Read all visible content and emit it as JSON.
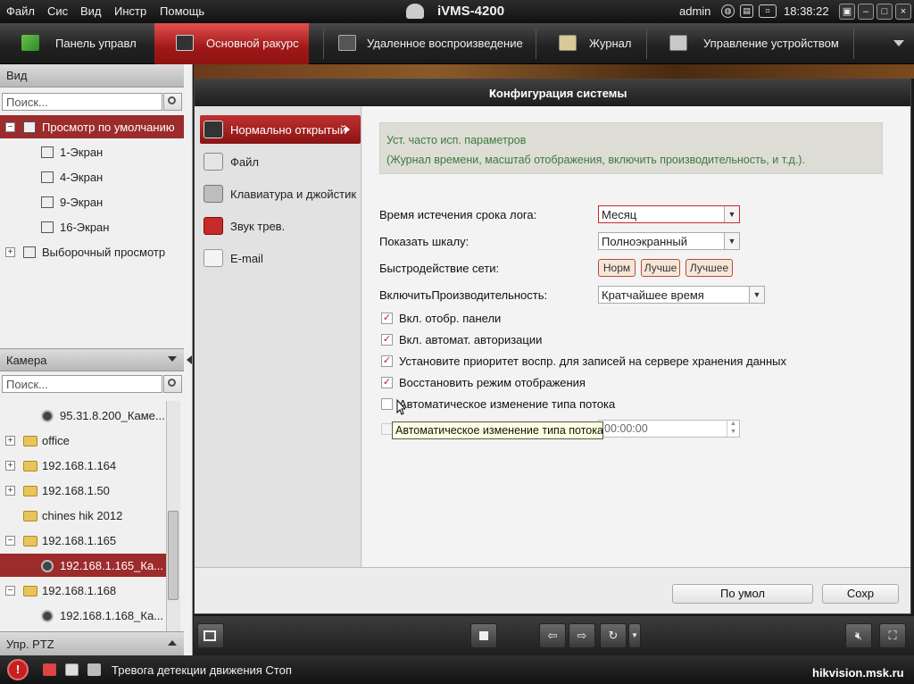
{
  "menubar": {
    "items": [
      "Файл",
      "Сис",
      "Вид",
      "Инстр",
      "Помощь"
    ],
    "app_title": "iVMS-4200",
    "user": "admin",
    "clock": "18:38:22"
  },
  "tabs": [
    {
      "label": "Панель управл",
      "icon": "grid-icon",
      "active": false
    },
    {
      "label": "Основной ракурс",
      "icon": "camera-view-icon",
      "active": true
    },
    {
      "label": "Удаленное воспроизведение",
      "icon": "playback-icon",
      "active": false
    },
    {
      "label": "Журнал",
      "icon": "log-icon",
      "active": false
    },
    {
      "label": "Управление устройством",
      "icon": "device-icon",
      "active": false
    }
  ],
  "view_panel": {
    "title": "Вид",
    "search_placeholder": "Поиск...",
    "tree": [
      {
        "label": "Просмотр по умолчанию",
        "level": 0,
        "expander": "−",
        "selected": true
      },
      {
        "label": "1-Экран",
        "level": 1
      },
      {
        "label": "4-Экран",
        "level": 1
      },
      {
        "label": "9-Экран",
        "level": 1
      },
      {
        "label": "16-Экран",
        "level": 1
      },
      {
        "label": "Выборочный просмотр",
        "level": 0,
        "expander": "+"
      }
    ]
  },
  "camera_panel": {
    "title": "Камера",
    "search_placeholder": "Поиск...",
    "tree": [
      {
        "label": "95.31.8.200_Каме...",
        "kind": "camera"
      },
      {
        "label": "office",
        "kind": "folder",
        "expander": "+"
      },
      {
        "label": "192.168.1.164",
        "kind": "folder",
        "expander": "+"
      },
      {
        "label": "192.168.1.50",
        "kind": "folder",
        "expander": "+"
      },
      {
        "label": "chines hik 2012",
        "kind": "folder"
      },
      {
        "label": "192.168.1.165",
        "kind": "folder",
        "expander": "−"
      },
      {
        "label": "192.168.1.165_Ка...",
        "kind": "camera",
        "selected": true
      },
      {
        "label": "192.168.1.168",
        "kind": "folder",
        "expander": "−"
      },
      {
        "label": "192.168.1.168_Ка...",
        "kind": "camera"
      }
    ]
  },
  "ptz_panel": {
    "title": "Упр. PTZ"
  },
  "dialog": {
    "title": "Конфигурация системы",
    "close": "×",
    "nav": [
      {
        "label": "Нормально открытый",
        "icon": "monitor-icon",
        "active": true
      },
      {
        "label": "Файл",
        "icon": "file-gear-icon"
      },
      {
        "label": "Клавиатура и джойстик",
        "icon": "keyboard-icon"
      },
      {
        "label": "Звук трев.",
        "icon": "alarm-sound-icon"
      },
      {
        "label": "E-mail",
        "icon": "email-icon"
      }
    ],
    "info": {
      "line1": "Уст. часто исп. параметров",
      "line2": "(Журнал времени, масштаб отображения, включить производительность, и т.д.)."
    },
    "form": {
      "log_expiry_label": "Время истечения срока лога:",
      "log_expiry_value": "Месяц",
      "show_scale_label": "Показать шкалу:",
      "show_scale_value": "Полноэкранный",
      "network_label": "Быстродействие сети:",
      "network_options": [
        "Норм",
        "Лучше",
        "Лучшее"
      ],
      "performance_label": "ВключитьПроизводительность:",
      "performance_value": "Кратчайшее время"
    },
    "checkboxes": [
      {
        "label": "Вкл. отобр. панели",
        "checked": true
      },
      {
        "label": "Вкл. автомат. авторизации",
        "checked": true
      },
      {
        "label": "Установите приоритет воспр. для записей на сервере хранения данных",
        "checked": true
      },
      {
        "label": "Восстановить режим отображения",
        "checked": true
      },
      {
        "label": "Автоматическое изменение типа потока",
        "checked": false
      }
    ],
    "time_value": "00:00:00",
    "tooltip": "Автоматическое изменение типа потока",
    "buttons": {
      "default": "По умол",
      "save": "Сохр"
    }
  },
  "statusbar": {
    "alarm_glyph": "!",
    "message": "Тревога детекции движения Стоп",
    "watermark": "hikvision.msk.ru"
  },
  "colors": {
    "accent": "#a01818",
    "selected": "#9c2b2b",
    "info_text": "#3d7a3d"
  }
}
